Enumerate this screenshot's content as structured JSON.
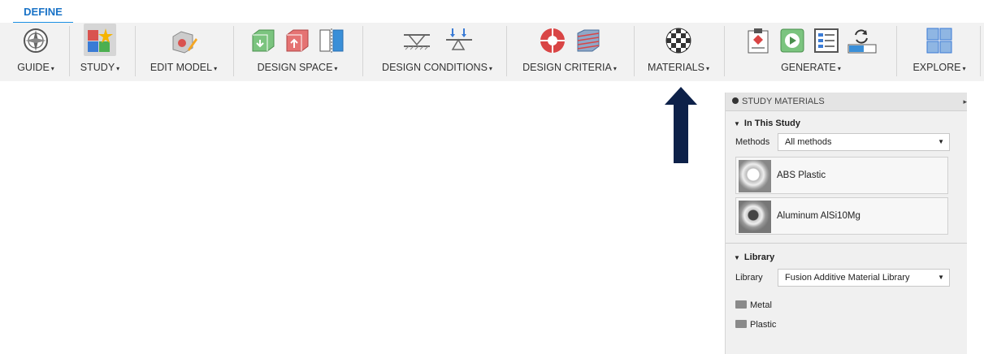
{
  "tabs": {
    "active": "DEFINE"
  },
  "toolbar": {
    "guide": "GUIDE",
    "study": "STUDY",
    "edit_model": "EDIT MODEL",
    "design_space": "DESIGN SPACE",
    "design_conditions": "DESIGN CONDITIONS",
    "design_criteria": "DESIGN CRITERIA",
    "materials": "MATERIALS",
    "generate": "GENERATE",
    "explore": "EXPLORE",
    "caret": "▾"
  },
  "panel": {
    "title": "STUDY MATERIALS",
    "in_study": {
      "title": "In This Study",
      "methods_label": "Methods",
      "methods_value": "All methods",
      "materials": [
        {
          "name": "ABS Plastic"
        },
        {
          "name": "Aluminum AlSi10Mg"
        }
      ]
    },
    "library": {
      "title": "Library",
      "library_label": "Library",
      "library_value": "Fusion Additive Material Library",
      "folders": [
        {
          "name": "Metal"
        },
        {
          "name": "Plastic"
        }
      ]
    }
  },
  "colors": {
    "accent": "#1a8fe3",
    "arrow": "#0d2149"
  }
}
